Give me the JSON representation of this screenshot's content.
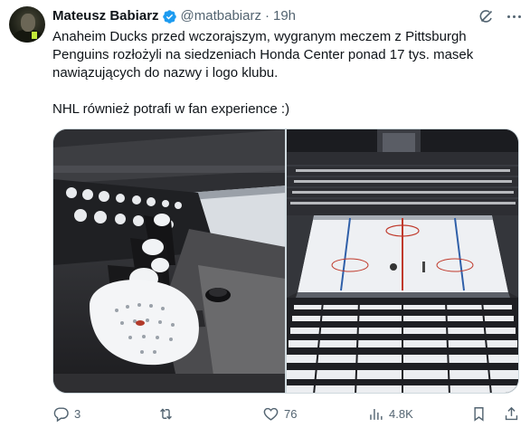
{
  "author": {
    "name": "Mateusz Babiarz",
    "handle": "@matbabiarz",
    "separator": "·",
    "time": "19h"
  },
  "tweet": {
    "paragraph1": "Anaheim Ducks przed wczorajszym, wygranym meczem z Pittsburgh Penguins rozłożyli na siedzeniach Honda Center ponad 17 tys. masek nawiązujących do nazwy i logo klubu.",
    "paragraph2": "NHL również potrafi w fan experience :)"
  },
  "actions": {
    "reply_count": "3",
    "retweet_count": "",
    "like_count": "76",
    "views_count": "4.8K"
  },
  "colors": {
    "verified": "#1d9bf0",
    "muted": "#536471",
    "text": "#0f1419"
  }
}
